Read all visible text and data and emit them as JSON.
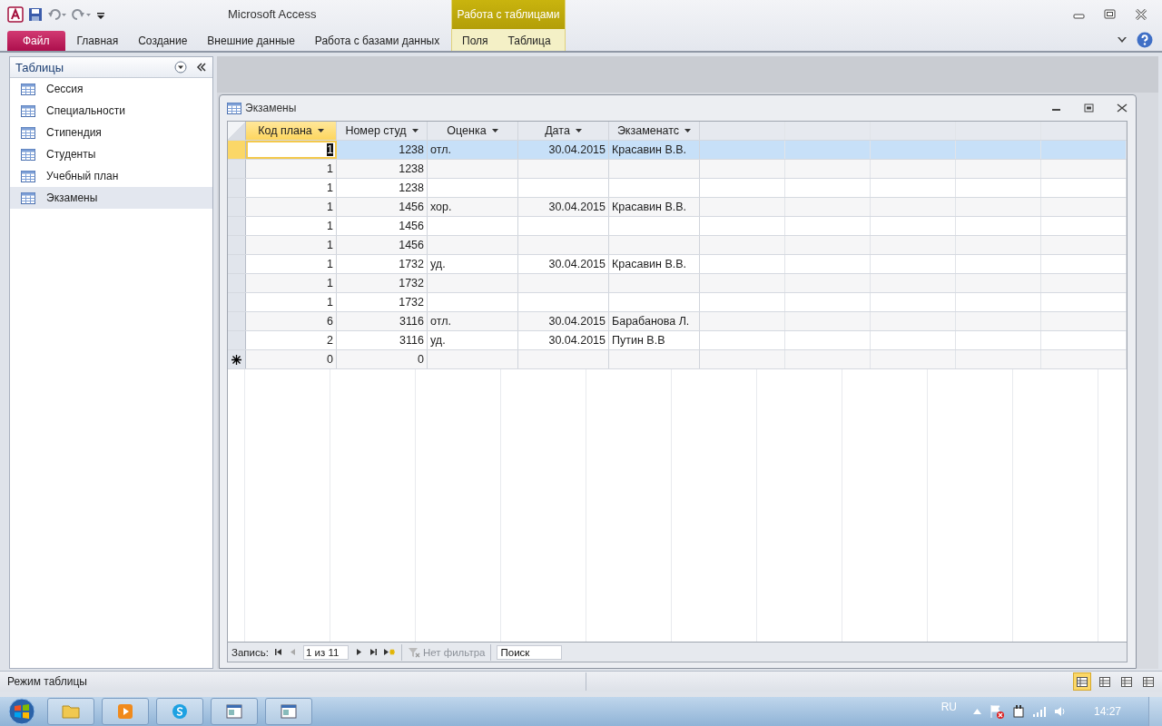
{
  "window": {
    "title": "Microsoft Access"
  },
  "ribbon": {
    "tabs": [
      {
        "label": "Файл",
        "kind": "file",
        "selected": false
      },
      {
        "label": "Главная",
        "kind": "tab",
        "selected": false
      },
      {
        "label": "Создание",
        "kind": "tab",
        "selected": false
      },
      {
        "label": "Внешние данные",
        "kind": "tab",
        "selected": false
      },
      {
        "label": "Работа с базами данных",
        "kind": "tab",
        "selected": false
      }
    ],
    "context_group": {
      "label": "Работа с таблицами",
      "tabs": [
        {
          "label": "Поля",
          "selected": false
        },
        {
          "label": "Таблица",
          "selected": false
        }
      ]
    }
  },
  "navigation_pane": {
    "title": "Таблицы",
    "items": [
      {
        "label": "Сессия",
        "selected": false
      },
      {
        "label": "Специальности",
        "selected": false
      },
      {
        "label": "Стипендия",
        "selected": false
      },
      {
        "label": "Студенты",
        "selected": false
      },
      {
        "label": "Учебный план",
        "selected": false
      },
      {
        "label": "Экзамены",
        "selected": true
      }
    ]
  },
  "document": {
    "title": "Экзамены",
    "columns": [
      {
        "label": "Код плана",
        "selected": true
      },
      {
        "label": "Номер студ",
        "selected": false
      },
      {
        "label": "Оценка",
        "selected": false
      },
      {
        "label": "Дата",
        "selected": false
      },
      {
        "label": "Экзаменатс",
        "selected": false
      }
    ],
    "rows": [
      {
        "kind": "record",
        "selected": true,
        "cells": [
          "1",
          "1238",
          "отл.",
          "30.04.2015",
          "Красавин В.В."
        ]
      },
      {
        "kind": "record",
        "selected": false,
        "cells": [
          "1",
          "1238",
          null,
          null,
          null
        ]
      },
      {
        "kind": "record",
        "selected": false,
        "cells": [
          "1",
          "1238",
          null,
          null,
          null
        ]
      },
      {
        "kind": "record",
        "selected": false,
        "cells": [
          "1",
          "1456",
          "хор.",
          "30.04.2015",
          "Красавин В.В."
        ]
      },
      {
        "kind": "record",
        "selected": false,
        "cells": [
          "1",
          "1456",
          null,
          null,
          null
        ]
      },
      {
        "kind": "record",
        "selected": false,
        "cells": [
          "1",
          "1456",
          null,
          null,
          null
        ]
      },
      {
        "kind": "record",
        "selected": false,
        "cells": [
          "1",
          "1732",
          "уд.",
          "30.04.2015",
          "Красавин В.В."
        ]
      },
      {
        "kind": "record",
        "selected": false,
        "cells": [
          "1",
          "1732",
          null,
          null,
          null
        ]
      },
      {
        "kind": "record",
        "selected": false,
        "cells": [
          "1",
          "1732",
          null,
          null,
          null
        ]
      },
      {
        "kind": "record",
        "selected": false,
        "cells": [
          "6",
          "3116",
          "отл.",
          "30.04.2015",
          "Барабанова Л."
        ]
      },
      {
        "kind": "record",
        "selected": false,
        "cells": [
          "2",
          "3116",
          "уд.",
          "30.04.2015",
          "Путин В.В"
        ]
      },
      {
        "kind": "new",
        "selected": false,
        "cells": [
          "0",
          "0",
          null,
          null,
          null
        ]
      }
    ],
    "record_nav": {
      "label": "Запись:",
      "position": "1 из 11",
      "filter": {
        "label": "Нет фильтра",
        "disabled": true
      },
      "search": {
        "placeholder": "Поиск"
      }
    }
  },
  "status_bar": {
    "text": "Режим таблицы",
    "views": [
      {
        "selected": true
      },
      {
        "selected": false
      },
      {
        "selected": false
      },
      {
        "selected": false
      }
    ]
  },
  "taskbar": {
    "apps": [
      {
        "kind": "folder"
      },
      {
        "kind": "media"
      },
      {
        "kind": "skype"
      },
      {
        "kind": "window"
      },
      {
        "kind": "window"
      }
    ],
    "language": "RU",
    "time": "14:27"
  }
}
